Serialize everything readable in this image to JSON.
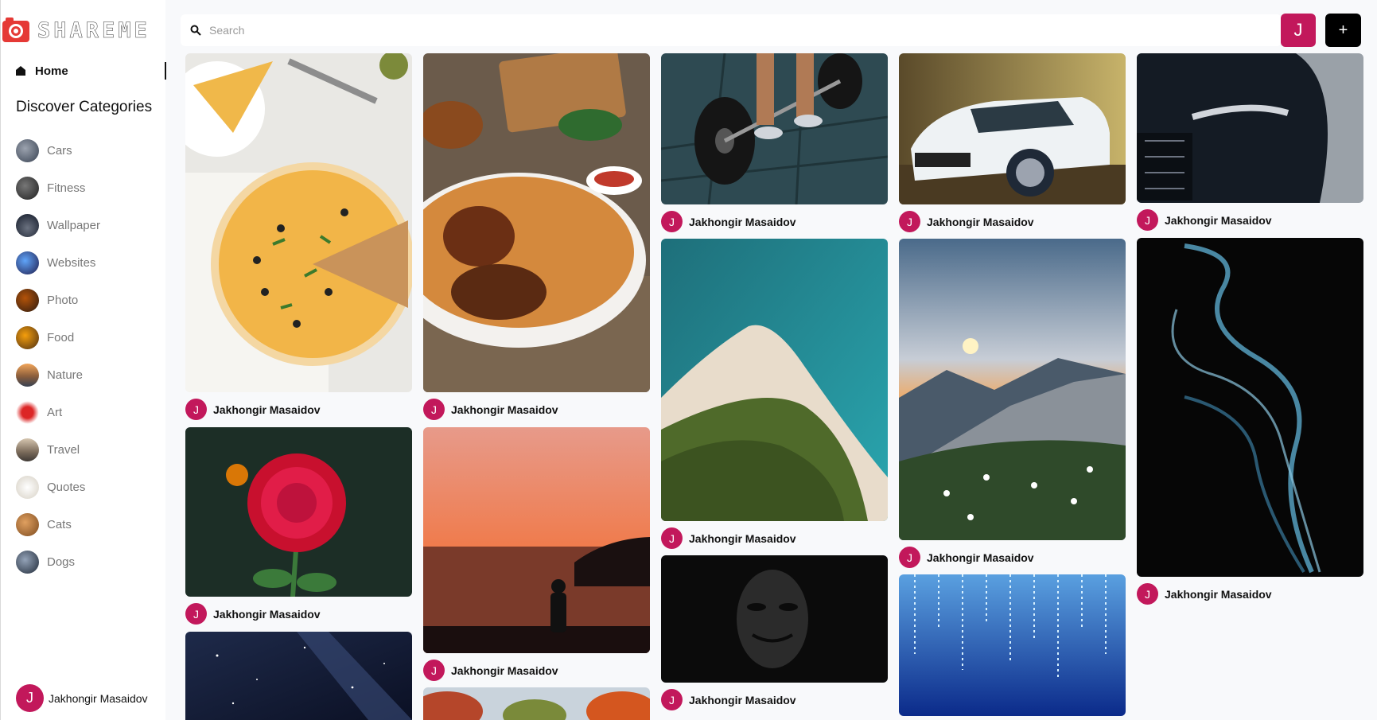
{
  "app": {
    "logo_text": "SHAREME"
  },
  "nav": {
    "home_label": "Home"
  },
  "sidebar": {
    "discover_title": "Discover Categories",
    "categories": [
      {
        "label": "Cars",
        "color": "#6b7280"
      },
      {
        "label": "Fitness",
        "color": "#2d2d2d"
      },
      {
        "label": "Wallpaper",
        "color": "#3a3f44"
      },
      {
        "label": "Websites",
        "color": "#1e3a8a"
      },
      {
        "label": "Photo",
        "color": "#5b3a29"
      },
      {
        "label": "Food",
        "color": "#a0612d"
      },
      {
        "label": "Nature",
        "color": "#8b5e3c"
      },
      {
        "label": "Art",
        "color": "#b91c1c"
      },
      {
        "label": "Travel",
        "color": "#7a6a5a"
      },
      {
        "label": "Quotes",
        "color": "#e5e1d8"
      },
      {
        "label": "Cats",
        "color": "#c08040"
      },
      {
        "label": "Dogs",
        "color": "#4b5563"
      }
    ]
  },
  "user": {
    "name": "Jakhongir Masaidov",
    "initial": "J"
  },
  "search": {
    "placeholder": "Search"
  },
  "header": {
    "add_label": "+"
  },
  "pins": [
    {
      "author": "Jakhongir Masaidov",
      "image": "pizza"
    },
    {
      "author": "Jakhongir Masaidov",
      "image": "biryani"
    },
    {
      "author": "Jakhongir Masaidov",
      "image": "barbell"
    },
    {
      "author": "Jakhongir Masaidov",
      "image": "white-car"
    },
    {
      "author": "Jakhongir Masaidov",
      "image": "black-car"
    },
    {
      "author": "Jakhongir Masaidov",
      "image": "beach-aerial"
    },
    {
      "author": "Jakhongir Masaidov",
      "image": "mountain-sunset"
    },
    {
      "author": "Jakhongir Masaidov",
      "image": "smoke"
    },
    {
      "author": "Jakhongir Masaidov",
      "image": "red-flower"
    },
    {
      "author": "Jakhongir Masaidov",
      "image": "sea-sunset"
    },
    {
      "author": "Jakhongir Masaidov",
      "image": "mask"
    },
    {
      "author": "Jakhongir Masaidov",
      "image": "milky-way"
    },
    {
      "author": "Jakhongir Masaidov",
      "image": "autumn-trees"
    },
    {
      "author": "Jakhongir Masaidov",
      "image": "binary-code"
    }
  ],
  "colors": {
    "accent": "#c2185b",
    "brand": "#e53935"
  }
}
